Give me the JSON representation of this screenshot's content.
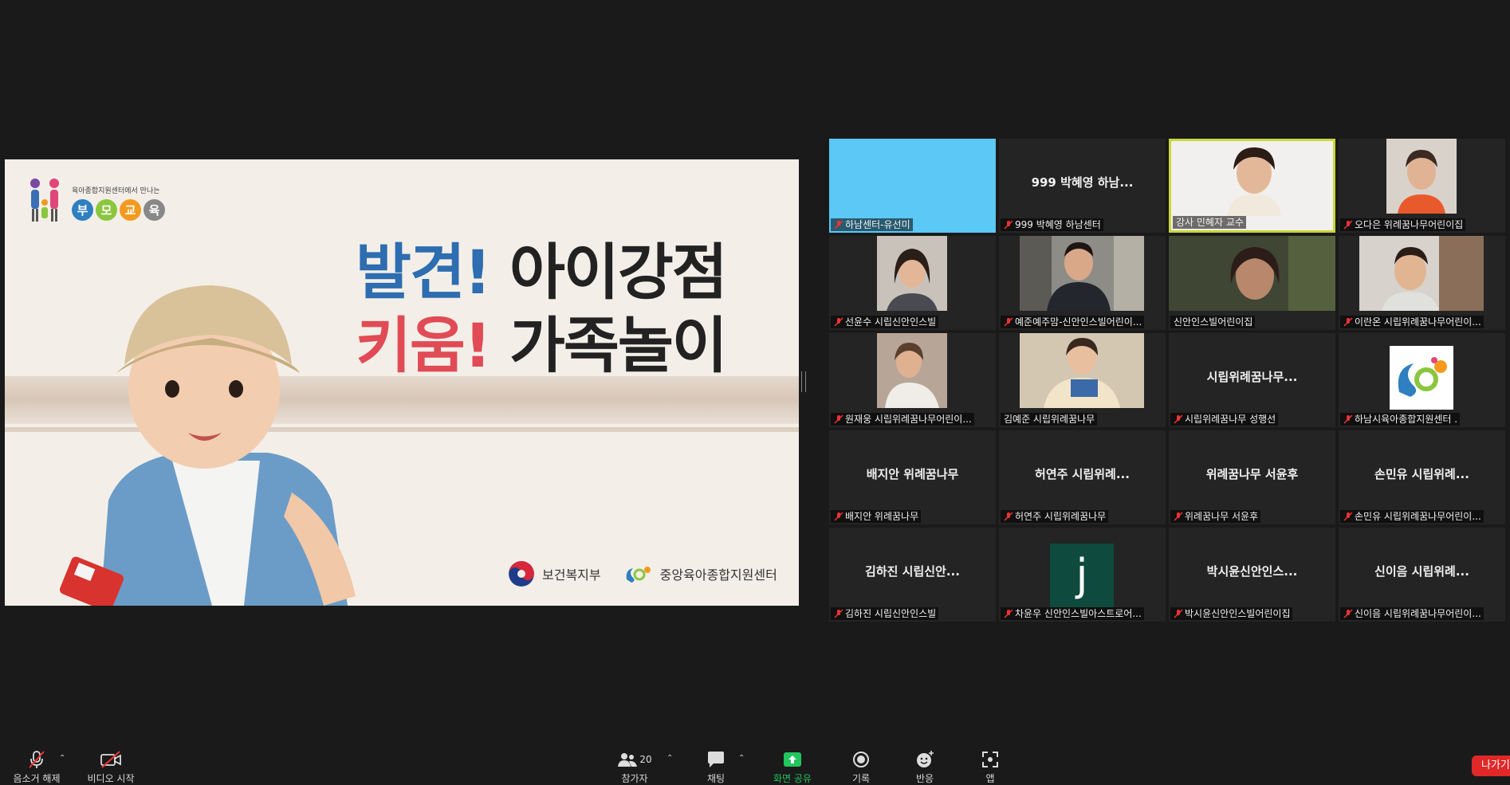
{
  "slide": {
    "logo_small_text": "육아종합지원센터에서 만나는",
    "logo_balls": [
      "부",
      "모",
      "교",
      "육"
    ],
    "logo_ball_colors": [
      "#2f7fc1",
      "#8bc63f",
      "#f39a1e",
      "#888888"
    ],
    "title_line1_accent": "발견!",
    "title_line1_rest": "아이강점",
    "title_line2_accent": "키움!",
    "title_line2_rest": "가족놀이",
    "footer_ministry": "보건복지부",
    "footer_center": "중앙육아종합지원센터"
  },
  "gallery": {
    "tiles": [
      {
        "label": "하남센터-유선미",
        "center_name": "",
        "type": "solid-blue",
        "muted": true
      },
      {
        "label": "999 박혜영 하남센터",
        "center_name": "999 박혜영 하남...",
        "type": "name",
        "muted": true
      },
      {
        "label": "강사 민혜자 교수",
        "center_name": "",
        "type": "video",
        "muted": false,
        "active": true
      },
      {
        "label": "오다은 위례꿈나무어린이집",
        "center_name": "",
        "type": "video",
        "muted": true
      },
      {
        "label": "선윤수 시립신안인스빌",
        "center_name": "",
        "type": "video",
        "muted": true
      },
      {
        "label": "예준예주맘-신안인스빌어린이...",
        "center_name": "",
        "type": "video",
        "muted": true
      },
      {
        "label": "신안인스빌어린이집",
        "center_name": "",
        "type": "video",
        "muted": false
      },
      {
        "label": "이란온 시립위례꿈나무어린이...",
        "center_name": "",
        "type": "video",
        "muted": true
      },
      {
        "label": "원재웅 시립위례꿈나무어린이...",
        "center_name": "",
        "type": "video",
        "muted": true
      },
      {
        "label": "김예준 시립위례꿈나무",
        "center_name": "",
        "type": "video",
        "muted": false
      },
      {
        "label": "시립위례꿈나무 성행선",
        "center_name": "시립위례꿈나무...",
        "type": "name",
        "muted": true
      },
      {
        "label": "하남시육아종합지원센터 .",
        "center_name": "",
        "type": "logo",
        "muted": true
      },
      {
        "label": "배지안 위례꿈나무",
        "center_name": "배지안 위례꿈나무",
        "type": "name",
        "muted": true
      },
      {
        "label": "허연주 시립위례꿈나무",
        "center_name": "허연주 시립위례...",
        "type": "name",
        "muted": true
      },
      {
        "label": "위례꿈나무 서윤후",
        "center_name": "위례꿈나무 서윤후",
        "type": "name",
        "muted": true
      },
      {
        "label": "손민유 시립위례꿈나무어린이...",
        "center_name": "손민유 시립위례...",
        "type": "name",
        "muted": true
      },
      {
        "label": "김하진 시립신안인스빌",
        "center_name": "김하진 시립신안...",
        "type": "name",
        "muted": true
      },
      {
        "label": "차윤우 신안인스빌아스트로어...",
        "center_name": "",
        "type": "avatar",
        "avatar_letter": "j",
        "muted": true
      },
      {
        "label": "박시윤신안인스빌어린이집",
        "center_name": "박시윤신안인스...",
        "type": "name",
        "muted": true
      },
      {
        "label": "신이음 시립위례꿈나무어린이...",
        "center_name": "신이음 시립위례...",
        "type": "name",
        "muted": true
      }
    ]
  },
  "toolbar": {
    "unmute_label": "음소거 해제",
    "video_label": "비디오 시작",
    "participants_label": "참가자",
    "participants_count": "20",
    "chat_label": "채팅",
    "share_label": "화면 공유",
    "record_label": "기록",
    "reactions_label": "반응",
    "apps_label": "앱",
    "leave_label": "나가기",
    "share_color": "#22c55e"
  }
}
